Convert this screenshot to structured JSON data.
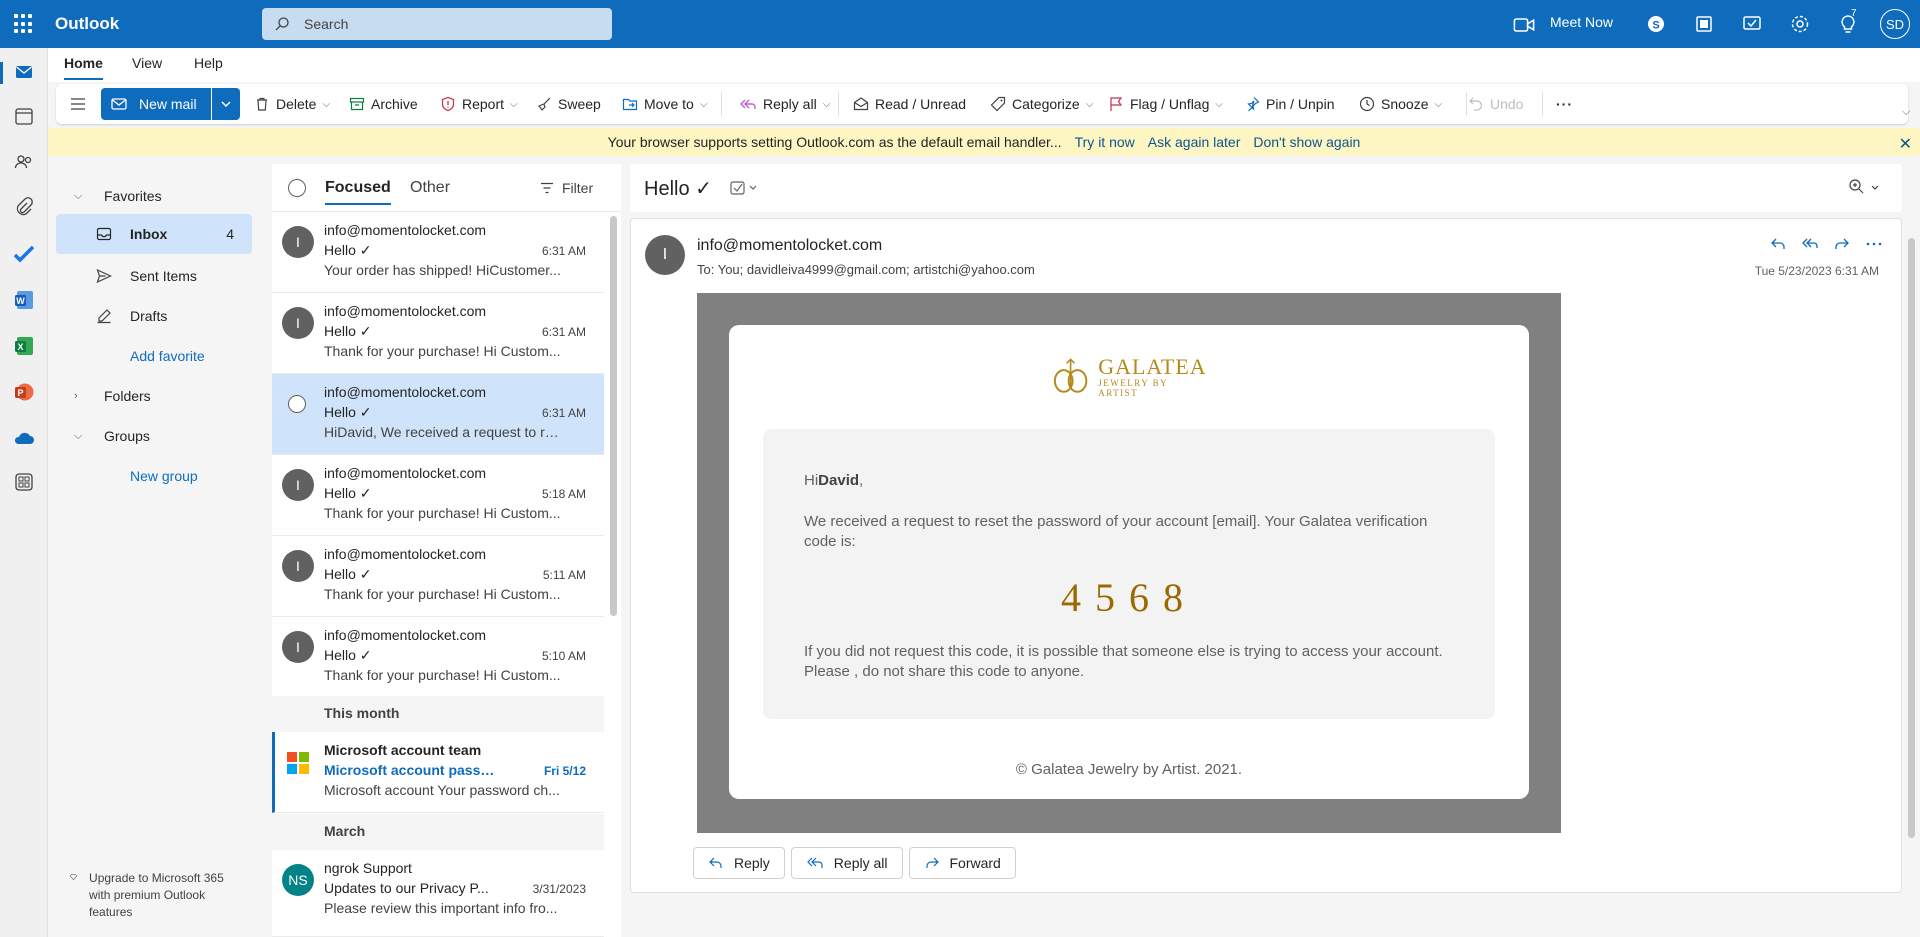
{
  "app": {
    "title": "Outlook"
  },
  "topbar": {
    "search_placeholder": "Search",
    "meet_now": "Meet Now",
    "tips_badge": "7",
    "avatar_initials": "SD"
  },
  "tabs": {
    "home": "Home",
    "view": "View",
    "help": "Help"
  },
  "ribbon": {
    "new_mail": "New mail",
    "delete": "Delete",
    "archive": "Archive",
    "report": "Report",
    "sweep": "Sweep",
    "move_to": "Move to",
    "reply_all": "Reply all",
    "read_unread": "Read / Unread",
    "categorize": "Categorize",
    "flag_unflag": "Flag / Unflag",
    "pin_unpin": "Pin / Unpin",
    "snooze": "Snooze",
    "undo": "Undo",
    "more": "···"
  },
  "infobar": {
    "message": "Your browser supports setting Outlook.com as the default email handler...",
    "try_now": "Try it now",
    "ask_later": "Ask again later",
    "dont_show": "Don't show again"
  },
  "nav": {
    "favorites": "Favorites",
    "inbox": "Inbox",
    "inbox_count": "4",
    "sent": "Sent Items",
    "drafts": "Drafts",
    "add_favorite": "Add favorite",
    "folders": "Folders",
    "groups": "Groups",
    "new_group": "New group",
    "upgrade": "Upgrade to Microsoft 365 with premium Outlook features"
  },
  "list": {
    "focused": "Focused",
    "other": "Other",
    "filter": "Filter",
    "group_this_month": "This month",
    "group_march": "March",
    "messages": [
      {
        "avatar": "I",
        "from": "info@momentolocket.com",
        "subject": "Hello ✓",
        "time": "6:31 AM",
        "preview": "Your order has shipped! HiCustomer..."
      },
      {
        "avatar": "I",
        "from": "info@momentolocket.com",
        "subject": "Hello ✓",
        "time": "6:31 AM",
        "preview": "Thank for your purchase! Hi Custom..."
      },
      {
        "avatar": "",
        "from": "info@momentolocket.com",
        "subject": "Hello ✓",
        "time": "6:31 AM",
        "preview": "HiDavid, We received a request to re..."
      },
      {
        "avatar": "I",
        "from": "info@momentolocket.com",
        "subject": "Hello ✓",
        "time": "5:18 AM",
        "preview": "Thank for your purchase! Hi Custom..."
      },
      {
        "avatar": "I",
        "from": "info@momentolocket.com",
        "subject": "Hello ✓",
        "time": "5:11 AM",
        "preview": "Thank for your purchase! Hi Custom..."
      },
      {
        "avatar": "I",
        "from": "info@momentolocket.com",
        "subject": "Hello ✓",
        "time": "5:10 AM",
        "preview": "Thank for your purchase! Hi Custom..."
      }
    ],
    "ms": {
      "from": "Microsoft account team",
      "subject": "Microsoft account passwo...",
      "time": "Fri 5/12",
      "preview": "Microsoft account Your password ch..."
    },
    "ngrok": {
      "avatar": "NS",
      "from": "ngrok Support",
      "subject": "Updates to our Privacy P...",
      "time": "3/31/2023",
      "preview": "Please review this important info fro..."
    }
  },
  "reading": {
    "subject": "Hello ✓",
    "sender_initial": "I",
    "from": "info@momentolocket.com",
    "to": "To:  You;  davidleiva4999@gmail.com;  artistchi@yahoo.com",
    "date": "Tue 5/23/2023 6:31 AM",
    "email": {
      "brand": "GALATEA",
      "tagline": "JEWELRY BY ARTIST",
      "hi": "Hi",
      "name": "David",
      "comma": ",",
      "body1": "We received a request to reset the password of your account [email]. Your Galatea verification code is:",
      "code": "4568",
      "body2": "If you did not request this code, it is possible that someone else is trying to access your account. Please , do not share this code to anyone.",
      "copyright": "© Galatea Jewelry by Artist. 2021."
    },
    "reply": "Reply",
    "reply_all": "Reply all",
    "forward": "Forward"
  },
  "colors": {
    "brand": "#0f6cbd",
    "selected": "#cfe4fa",
    "infobar": "#fdf6c3",
    "gold": "#b48a1a"
  }
}
